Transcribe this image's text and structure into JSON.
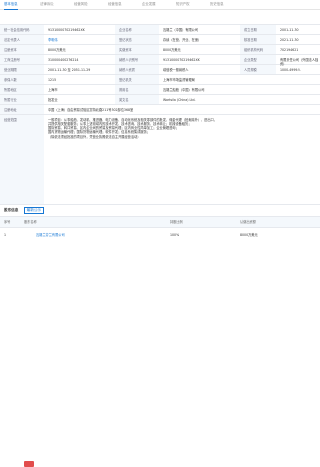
{
  "tabs": [
    {
      "label": "基本信息",
      "active": true
    },
    {
      "label": "法律诉讼",
      "active": false
    },
    {
      "label": "经营风险",
      "active": false
    },
    {
      "label": "经营信息",
      "active": false
    },
    {
      "label": "企业发展",
      "active": false
    },
    {
      "label": "知识产权",
      "active": false
    },
    {
      "label": "历史信息",
      "active": false
    }
  ],
  "rows": [
    {
      "cells": [
        {
          "label": "统一社会信用代码",
          "value": "9131000070219462XK"
        },
        {
          "label": "企业名称",
          "value": "瓦锡兰（中国）有限公司"
        },
        {
          "label": "成立日期",
          "value": "2001-11-30"
        }
      ]
    },
    {
      "cells": [
        {
          "label": "法定代表人",
          "value": "李明伟",
          "link": true
        },
        {
          "label": "登记状态",
          "value": "存续（在营、开业、在册）"
        },
        {
          "label": "核准日期",
          "value": "2021-11-30"
        }
      ]
    },
    {
      "cells": [
        {
          "label": "注册资本",
          "value": "8000万美元"
        },
        {
          "label": "实缴资本",
          "value": "8000万美元"
        },
        {
          "label": "组织机构代码",
          "value": "702194621"
        }
      ]
    },
    {
      "cells": [
        {
          "label": "工商注册号",
          "value": "310000400276214"
        },
        {
          "label": "纳税人识别号",
          "value": "9131000070219462XK"
        },
        {
          "label": "企业类型",
          "value": "有限责任公司（外国法人独资）"
        }
      ]
    },
    {
      "cells": [
        {
          "label": "营业期限",
          "value": "2001-11-30 至 2051-11-29"
        },
        {
          "label": "纳税人资质",
          "value": "增值税一般纳税人"
        },
        {
          "label": "人员规模",
          "value": "1000-4999人"
        }
      ]
    },
    {
      "cells": [
        {
          "label": "参保人数",
          "value": "1215"
        },
        {
          "label": "登记机关",
          "value": "上海市市场监督管理局"
        }
      ]
    },
    {
      "cells": [
        {
          "label": "所属地区",
          "value": "上海市"
        },
        {
          "label": "曾用名",
          "value": "瓦锡兰船舶（中国）有限公司"
        }
      ]
    },
    {
      "cells": [
        {
          "label": "所属行业",
          "value": "批发业"
        },
        {
          "label": "英文名",
          "value": "Wartsila (China) Ltd."
        }
      ]
    }
  ],
  "address": {
    "label": "注册地址",
    "value": "中国（上海）自由贸易试验区富特北路211号302部位368室"
  },
  "scope": {
    "label": "经营范围",
    "lines": [
      "一般项目：从事船舶、发动机、推进器、电力设备、自动化系统及相关零部件的批发、佣金代理（拍卖除外）、进出口，",
      "并提供相关配套服务；从事上述领域内的技术开发、技术咨询、技术服务、技术转让；机械设备租赁；",
      "国际贸易、转口贸易、区内企业间的贸易及贸易代理；区内商业性简单加工；企业管理咨询；",
      "国内货物运输代理；国际货物运输代理；软件开发；信息系统集成服务；",
      "（除依法须经批准的项目外，凭营业执照依法自主开展经营活动）"
    ]
  },
  "section": {
    "title": "股东信息",
    "badge": "最新公示"
  },
  "table": {
    "headers": [
      "序号",
      "股东名称",
      "持股比例",
      "认缴出资额"
    ]
  },
  "shareholder": {
    "index": "1",
    "name": "瓦锡兰芬兰有限公司",
    "percent": "100%",
    "amount": "8000万美元"
  }
}
